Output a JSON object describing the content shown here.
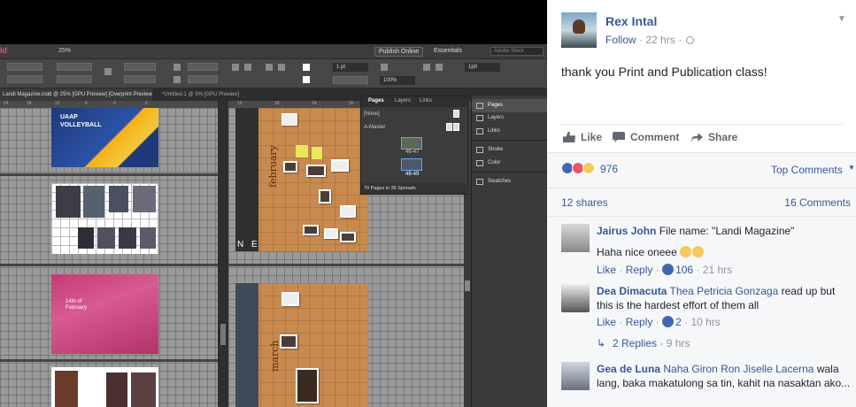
{
  "photo": {
    "app_logo": "Id",
    "zoom_select": "25%",
    "publish_online": "Publish Online",
    "workspace": "Essentials",
    "search_placeholder": "Adobe Stock",
    "stroke_weight": "1 pt",
    "frame_zoom": "100%",
    "corner_size": "1p0",
    "doc_tab_active": "Landi Magazine.indd @ 25% [GPU Preview] [Overprint Preview]",
    "doc_tab_second": "*Untitled-1 @ 5% [GPU Preview]",
    "ruler_labels": [
      "24",
      "18",
      "12",
      "6",
      "0",
      "6",
      "12",
      "18",
      "24",
      "30"
    ],
    "uaap_title": "UAAP",
    "uaap_subtitle": "VOLLEYBALL",
    "feb_line1": "14th of",
    "feb_line2": "February",
    "month_a": "february",
    "month_b": "march",
    "cork_letters": "N E",
    "pages_panel": {
      "tabs": [
        "Pages",
        "Layers",
        "Links"
      ],
      "none_label": "[None]",
      "master_label": "A-Master",
      "spread_a": "46-47",
      "spread_b": "48-49",
      "footer": "70 Pages in 36 Spreads"
    },
    "dock_items": [
      "Pages",
      "Layers",
      "Links",
      "Stroke",
      "Color",
      "Swatches"
    ]
  },
  "post": {
    "author": "Rex Intal",
    "follow": "Follow",
    "time": "22 hrs",
    "menu_icon": "chevron-down-icon",
    "text": "thank you Print and Publication class!",
    "actions": [
      "Like",
      "Comment",
      "Share"
    ],
    "reaction_count": "976",
    "top_comments": "Top Comments",
    "shares": "12 shares",
    "comments_count": "16 Comments",
    "colors": {
      "link": "#365899",
      "meta": "#90949c",
      "like_blue": "#4267b2",
      "love_red": "#f25268",
      "wow_yellow": "#f7c95a"
    }
  },
  "comments": [
    {
      "name": "Jairus John",
      "text": "File name: \"Landi Magazine\"",
      "line2": "Haha nice oneee",
      "like": "Like",
      "reply": "Reply",
      "reactions": "106",
      "time": "21 hrs"
    },
    {
      "name": "Dea Dimacuta",
      "tag": "Thea Petricia Gonzaga",
      "text": "read up but this is the hardest effort of them all",
      "like": "Like",
      "reply": "Reply",
      "reactions": "2",
      "time": "10 hrs",
      "replies": "2 Replies",
      "replies_time": "9 hrs"
    },
    {
      "name": "Gea de Luna",
      "tag": "Naha Giron Ron Jiselle Lacerna",
      "text": "wala lang, baka makatulong sa tin, kahit na nasaktan ako..."
    }
  ]
}
